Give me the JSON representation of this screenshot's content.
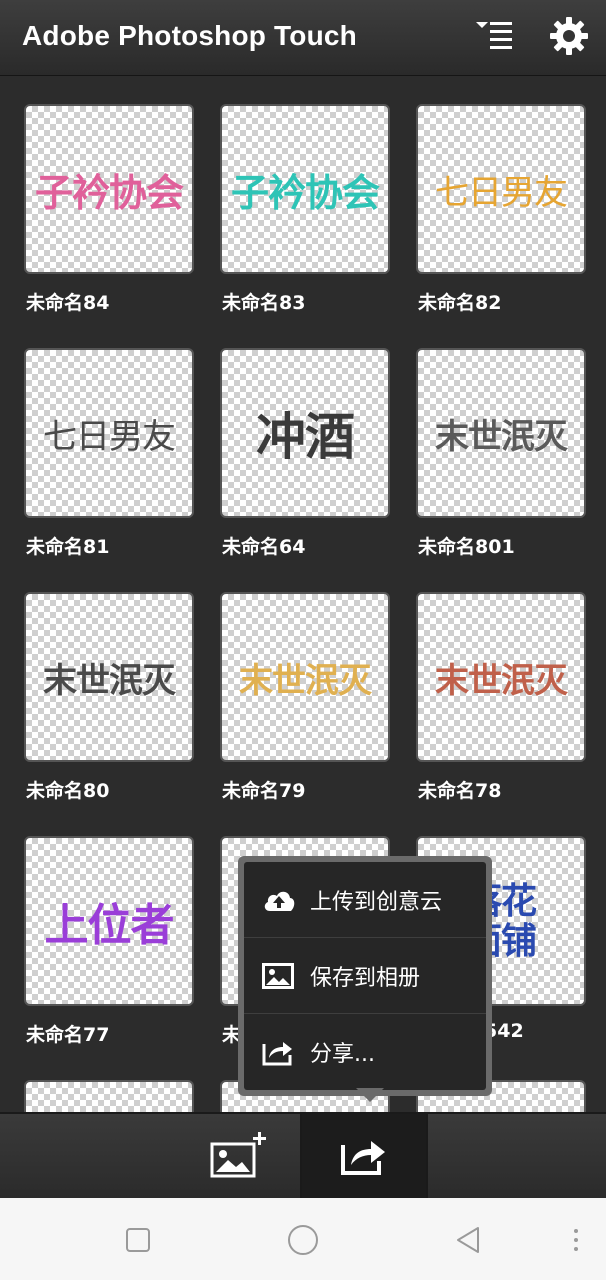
{
  "header": {
    "title": "Adobe Photoshop Touch",
    "icons": [
      "sort-menu-icon",
      "gear-icon"
    ]
  },
  "projects": [
    {
      "label": "未命名84",
      "art": "子衿协会",
      "color": "#e0609a"
    },
    {
      "label": "未命名83",
      "art": "子衿协会",
      "color": "#2ec4b6"
    },
    {
      "label": "未命名82",
      "art": "七日男友",
      "color": "#e6a532"
    },
    {
      "label": "未命名81",
      "art": "七日男友",
      "color": "#4a4a4a"
    },
    {
      "label": "未命名64",
      "art": "冲酒",
      "color": "#3a3a3a"
    },
    {
      "label": "未命名801",
      "art": "末世泯灭",
      "color": "#5a5a5a"
    },
    {
      "label": "未命名80",
      "art": "末世泯灭",
      "color": "#4a4a4a"
    },
    {
      "label": "未命名79",
      "art": "末世泯灭",
      "color": "#e0b050"
    },
    {
      "label": "未命名78",
      "art": "末世泯灭",
      "color": "#c0604a"
    },
    {
      "label": "未命名77",
      "art": "上位者",
      "color": "#9a3ed8"
    },
    {
      "label": "未",
      "art": "",
      "color": "#888888"
    },
    {
      "label": "542",
      "art": "落花\n面铺",
      "color": "#2a4ab0"
    }
  ],
  "popup_menu": {
    "items": [
      {
        "label": "上传到创意云",
        "icon": "cloud-upload-icon"
      },
      {
        "label": "保存到相册",
        "icon": "image-icon"
      },
      {
        "label": "分享...",
        "icon": "share-icon"
      }
    ]
  },
  "toolbar": {
    "buttons": [
      "add-image-icon",
      "share-icon"
    ]
  },
  "navbar": {
    "buttons": [
      "recent-apps-icon",
      "home-icon",
      "back-icon",
      "more-icon"
    ]
  }
}
